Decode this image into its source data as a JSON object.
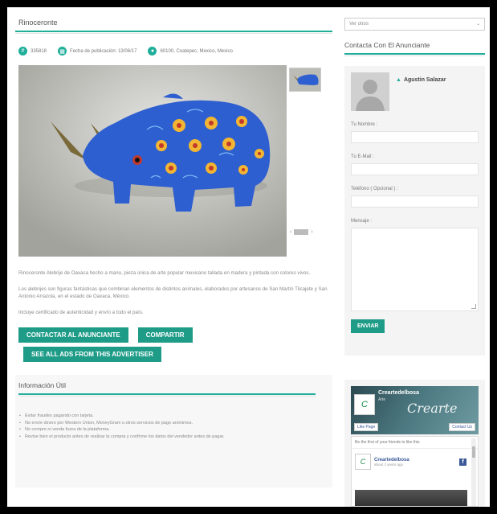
{
  "listing": {
    "title": "Rinoceronte",
    "meta": {
      "id": "335818",
      "date": "Fecha de publicación: 13/06/17",
      "location": "60100, Coatepec, Mexico, Mexico"
    },
    "description": [
      "Rinoceronte Alebrije de Oaxaca hecho a mano, pieza única de arte popular mexicano tallada en madera y pintada con colores vivos.",
      "Los alebrijes son figuras fantásticas que combinan elementos de distintos animales, elaborados por artesanos de San Martín Tilcajete y San Antonio Arrazola, en el estado de Oaxaca, México.",
      "Incluye certificado de autenticidad y envío a todo el país."
    ],
    "buttons": {
      "contact": "CONTACTAR AL ANUNCIANTE",
      "share": "COMPARTIR",
      "see_all": "SEE ALL ADS FROM THIS ADVERTISER"
    }
  },
  "useful_info": {
    "title": "Información Útil",
    "items": [
      "Evitar fraudes pagando con tarjeta.",
      "No envíe dinero por Western Union, MoneyGram u otros servicios de pago anónimos.",
      "No compre ni venda fuera de la plataforma.",
      "Revise bien el producto antes de realizar la compra y confirme los datos del vendedor antes de pagar."
    ]
  },
  "sidebar": {
    "sort_label": "Ver otros",
    "contact_title": "Contacta Con El Anunciante",
    "advertiser_name": "Agustin Salazar",
    "form": {
      "name_label": "Tu Nombre :",
      "email_label": "Tu E-Mail :",
      "phone_label": "Teléfono ( Opcional ) :",
      "message_label": "Mensaje :",
      "send_label": "ENVIAR"
    },
    "facebook": {
      "page_name": "Creartedelbosa",
      "page_sub": "Arte",
      "cover_script": "Crearte",
      "like_label": "Like Page",
      "contact_label": "Contact Us",
      "first_line": "Be the first of your friends to like this",
      "post_name": "Creartedelbosa",
      "post_time": "about 2 years ago"
    }
  },
  "colors": {
    "accent": "#1fae9a",
    "button": "#1f9c88",
    "rhino_blue": "#2e5fd0",
    "facebook": "#3b5998"
  }
}
